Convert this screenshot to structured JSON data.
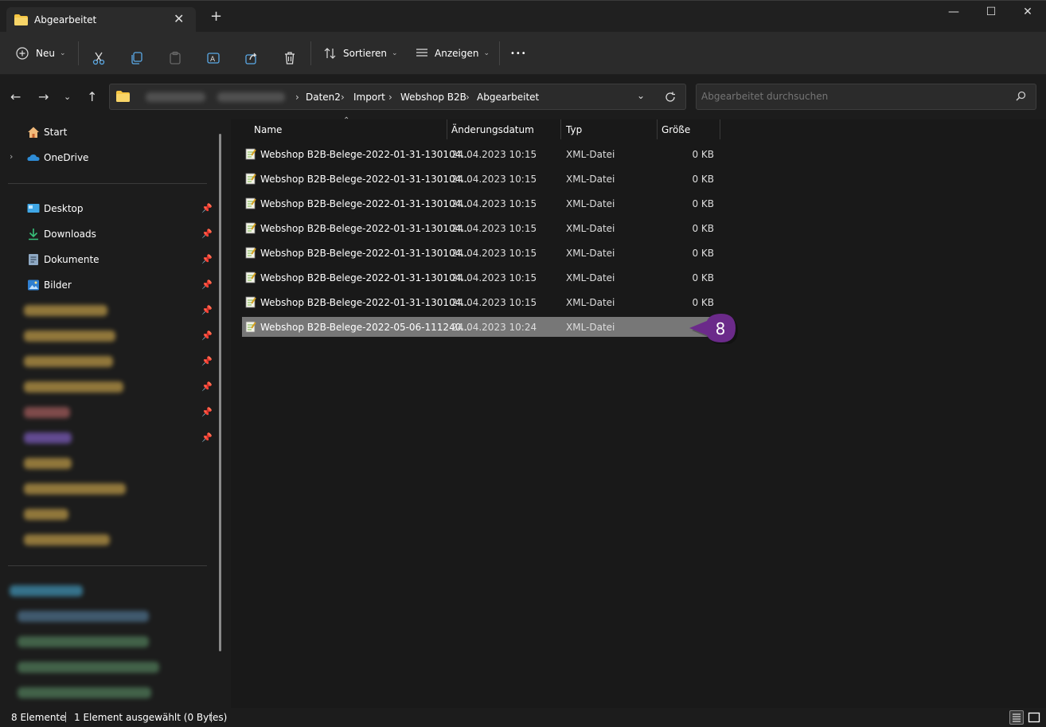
{
  "window": {
    "tab_title": "Abgearbeitet",
    "new_tab": "+",
    "minimize": "—",
    "maximize": "☐",
    "close": "✕",
    "tab_close": "✕"
  },
  "toolbar": {
    "new_label": "Neu",
    "sort_label": "Sortieren",
    "view_label": "Anzeigen",
    "more_label": "•••"
  },
  "address": {
    "crumbs": [
      "Daten2",
      "Import",
      "Webshop B2B",
      "Abgearbeitet"
    ],
    "separator": "›",
    "search_placeholder": "Abgearbeitet durchsuchen"
  },
  "sidebar": {
    "start": "Start",
    "onedrive": "OneDrive",
    "pinned": [
      {
        "label": "Desktop",
        "icon": "desktop-icon"
      },
      {
        "label": "Downloads",
        "icon": "download-icon"
      },
      {
        "label": "Dokumente",
        "icon": "document-icon"
      },
      {
        "label": "Bilder",
        "icon": "pictures-icon"
      }
    ]
  },
  "columns": {
    "name": "Name",
    "date": "Änderungsdatum",
    "type": "Typ",
    "size": "Größe"
  },
  "files": [
    {
      "name": "Webshop B2B-Belege-2022-01-31-130104...",
      "date": "24.04.2023 10:15",
      "type": "XML-Datei",
      "size": "0 KB"
    },
    {
      "name": "Webshop B2B-Belege-2022-01-31-130104...",
      "date": "24.04.2023 10:15",
      "type": "XML-Datei",
      "size": "0 KB"
    },
    {
      "name": "Webshop B2B-Belege-2022-01-31-130104...",
      "date": "24.04.2023 10:15",
      "type": "XML-Datei",
      "size": "0 KB"
    },
    {
      "name": "Webshop B2B-Belege-2022-01-31-130104...",
      "date": "24.04.2023 10:15",
      "type": "XML-Datei",
      "size": "0 KB"
    },
    {
      "name": "Webshop B2B-Belege-2022-01-31-130104...",
      "date": "24.04.2023 10:15",
      "type": "XML-Datei",
      "size": "0 KB"
    },
    {
      "name": "Webshop B2B-Belege-2022-01-31-130104...",
      "date": "24.04.2023 10:15",
      "type": "XML-Datei",
      "size": "0 KB"
    },
    {
      "name": "Webshop B2B-Belege-2022-01-31-130104...",
      "date": "24.04.2023 10:15",
      "type": "XML-Datei",
      "size": "0 KB"
    },
    {
      "name": "Webshop B2B-Belege-2022-05-06-111240...",
      "date": "24.04.2023 10:24",
      "type": "XML-Datei",
      "size": ""
    }
  ],
  "callout": {
    "number": "8",
    "color": "#6b2a8a"
  },
  "status": {
    "count": "8 Elemente",
    "selection": "1 Element ausgewählt (0 Bytes)"
  },
  "colors": {
    "background": "#191919",
    "selected_row": "#777777",
    "folder": "#f5c542"
  }
}
